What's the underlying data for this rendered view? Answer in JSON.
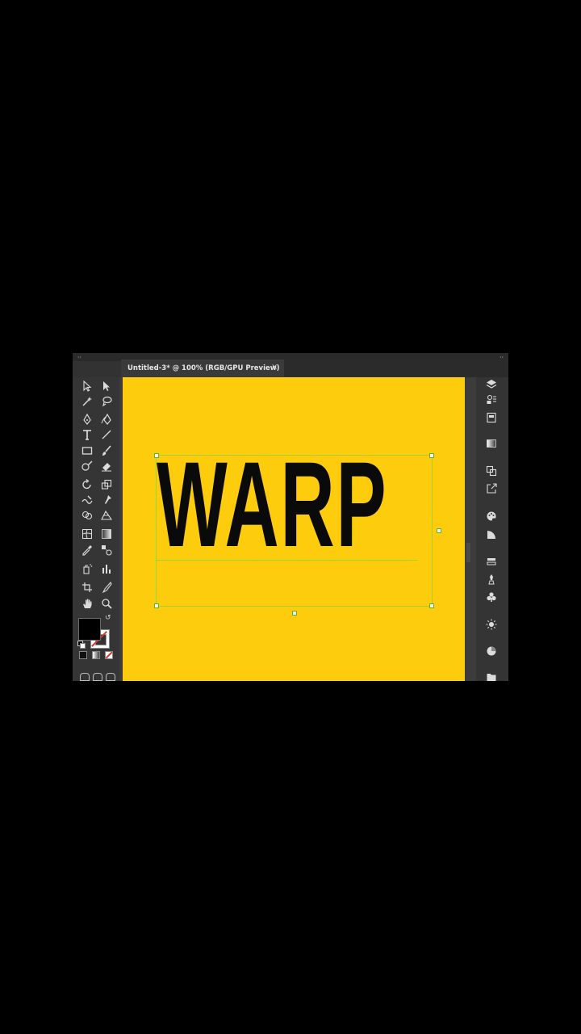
{
  "document_tab": {
    "title": "Untitled-3* @ 100% (RGB/GPU Preview)",
    "close_glyph": "×"
  },
  "panel_collapse_glyph": "‹‹",
  "artboard": {
    "text": "WARP",
    "background_color": "#fdcc0d",
    "text_color": "#0a0a0a",
    "selection_color": "#7cd44a"
  },
  "toolbar": {
    "tools": [
      "selection-tool-icon",
      "direct-selection-tool-icon",
      "magic-wand-tool-icon",
      "lasso-tool-icon",
      "pen-tool-icon",
      "curvature-tool-icon",
      "type-tool-icon",
      "line-segment-tool-icon",
      "rectangle-tool-icon",
      "paintbrush-tool-icon",
      "shaper-tool-icon",
      "eraser-tool-icon",
      "rotate-tool-icon",
      "scale-tool-icon",
      "warp-tool-icon",
      "puppet-warp-tool-icon",
      "shape-builder-tool-icon",
      "perspective-grid-tool-icon",
      "mesh-tool-icon",
      "gradient-tool-icon",
      "eyedropper-tool-icon",
      "blend-tool-icon",
      "symbol-sprayer-tool-icon",
      "column-graph-tool-icon",
      "artboard-tool-icon",
      "slice-tool-icon",
      "hand-tool-icon",
      "zoom-tool-icon"
    ],
    "fill_color": "#000000",
    "stroke_color": "#ffffff"
  },
  "right_panel": {
    "icons": [
      "layers-icon",
      "libraries-icon",
      "properties-icon",
      "gradient-panel-icon",
      "artboards-panel-icon",
      "export-icon",
      "color-panel-icon",
      "transparency-icon",
      "align-icon",
      "brushes-icon",
      "symbols-icon",
      "sun-icon",
      "color-guide-icon",
      "folder-icon"
    ]
  }
}
